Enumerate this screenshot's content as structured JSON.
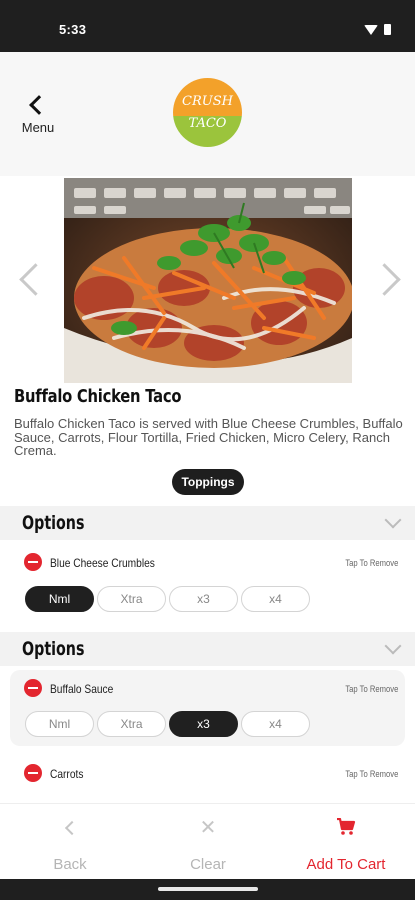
{
  "status_bar": {
    "time": "5:33"
  },
  "header": {
    "back_label": "Menu",
    "logo_line1": "CRUSH",
    "logo_line2": "TACO"
  },
  "product": {
    "title": "Buffalo Chicken Taco",
    "description": "Buffalo Chicken Taco is served with Blue Cheese Crumbles, Buffalo Sauce, Carrots, Flour Tortilla, Fried Chicken, Micro Celery, Ranch Crema.",
    "toppings_button": "Toppings"
  },
  "option_groups": [
    {
      "header": "Options",
      "item": "Blue Cheese Crumbles",
      "tap_to_remove": "Tap To Remove",
      "choices": [
        "Nml",
        "Xtra",
        "x3",
        "x4"
      ],
      "selected": "Nml"
    },
    {
      "header": "Options",
      "item": "Buffalo Sauce",
      "tap_to_remove": "Tap To Remove",
      "choices": [
        "Nml",
        "Xtra",
        "x3",
        "x4"
      ],
      "selected": "x3"
    },
    {
      "item": "Carrots",
      "tap_to_remove": "Tap To Remove"
    }
  ],
  "bottom_bar": {
    "back": "Back",
    "clear": "Clear",
    "add_to_cart": "Add To Cart"
  },
  "colors": {
    "accent_red": "#e3262f",
    "logo_orange": "#f3a12a",
    "logo_green": "#9bc43c",
    "pill_active": "#202020"
  }
}
